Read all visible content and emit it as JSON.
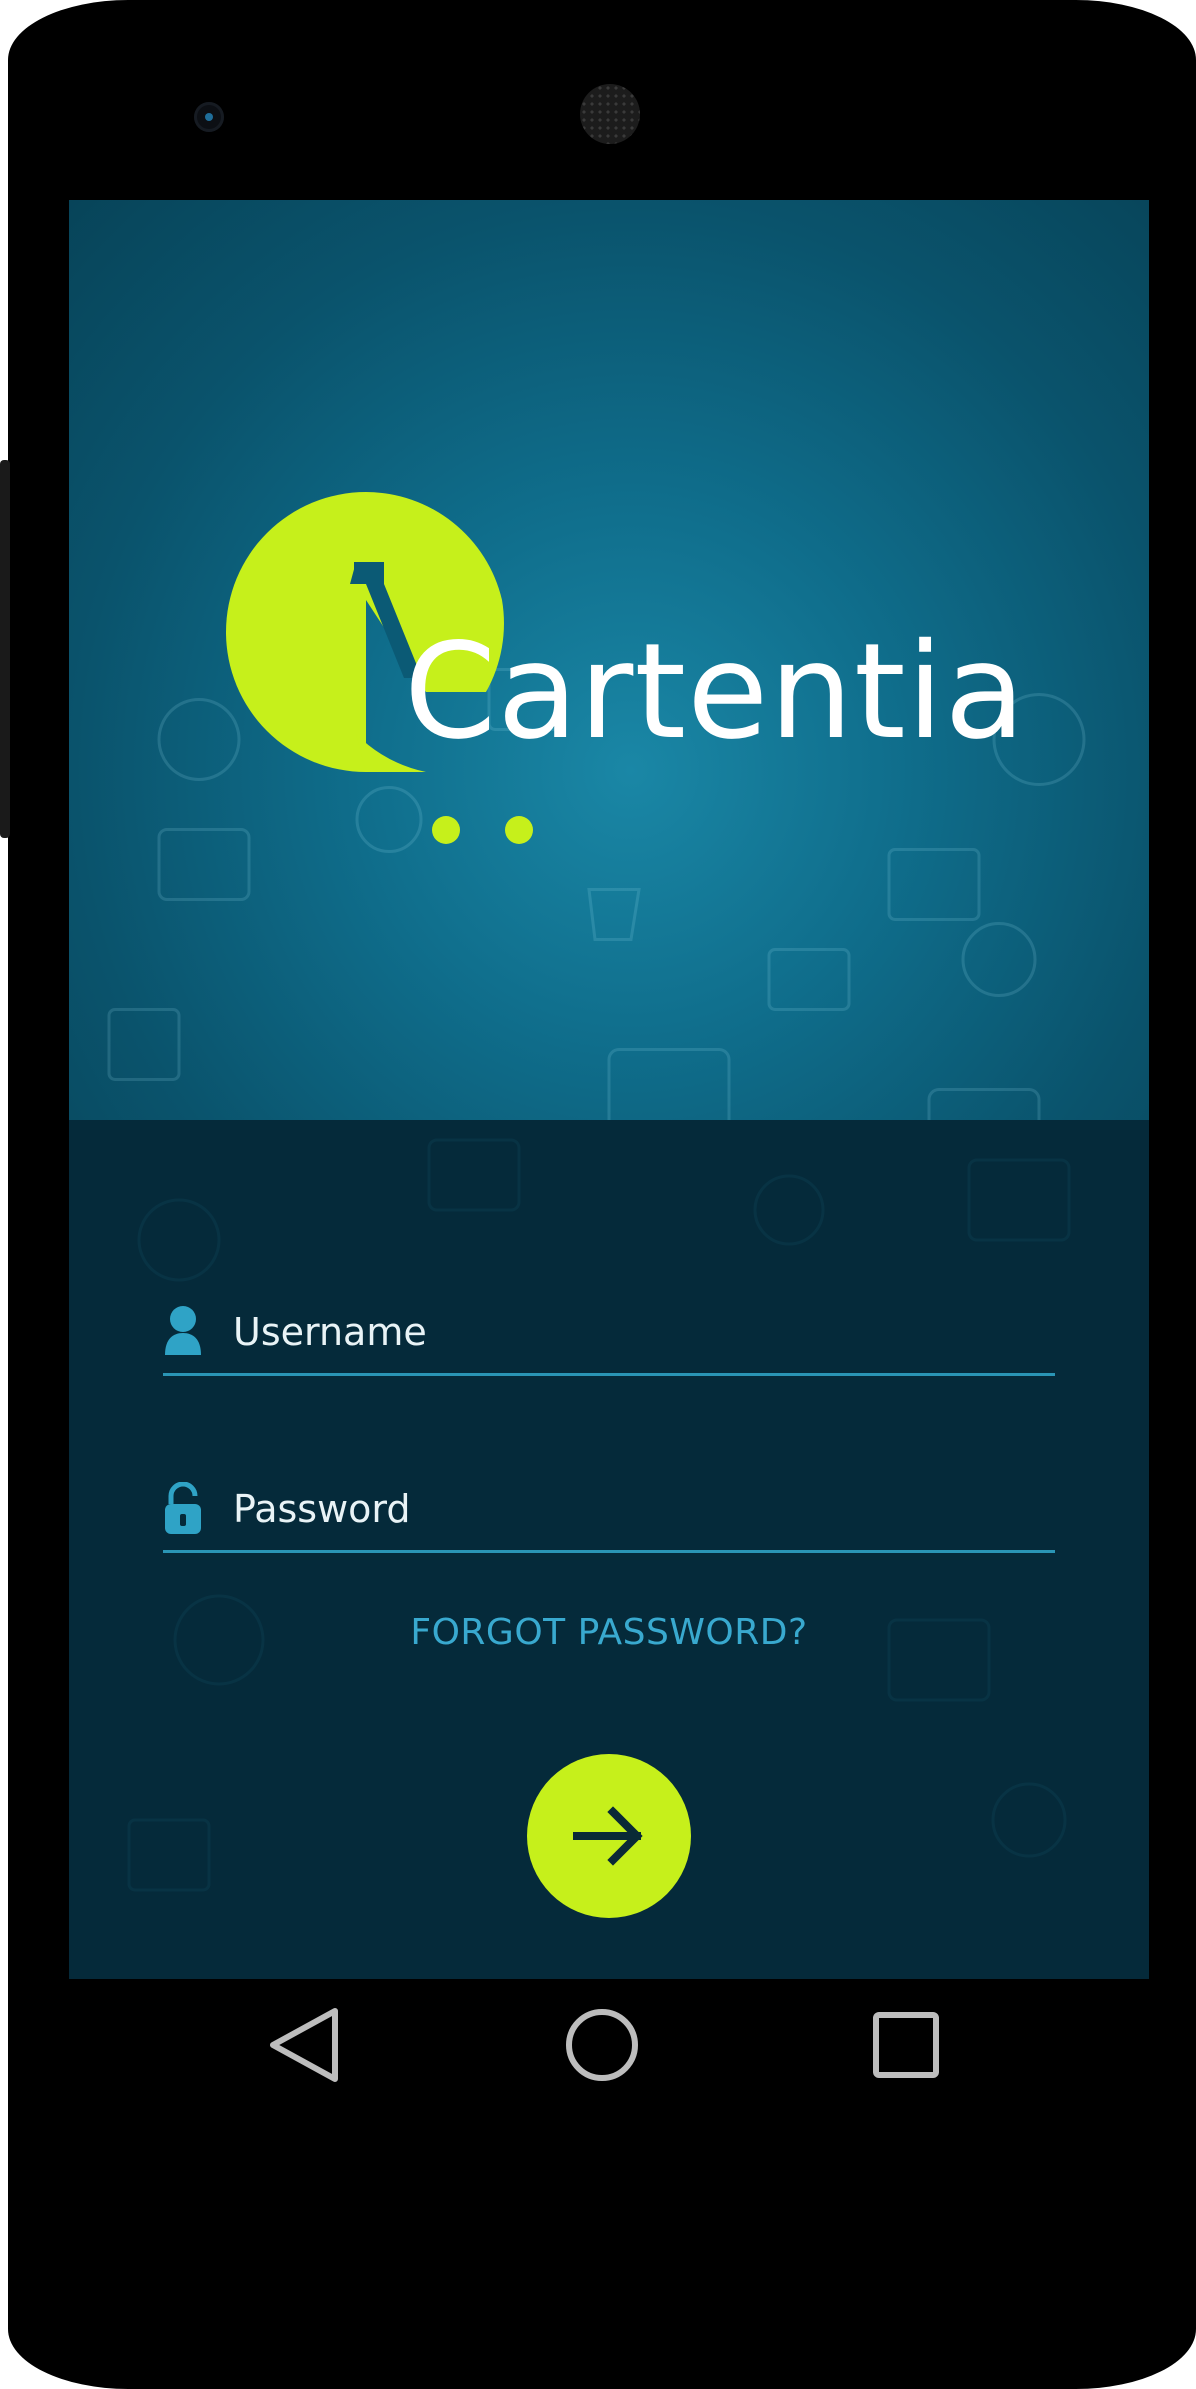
{
  "app": {
    "brand_name": "Cartentia",
    "brand_color": "#c6f01b",
    "background_color": "#0a536c"
  },
  "login": {
    "username_placeholder": "Username",
    "password_placeholder": "Password",
    "username_icon": "user-icon",
    "password_icon": "unlock-icon",
    "forgot_password_label": "FORGOT PASSWORD?",
    "submit_icon": "arrow-right-icon"
  },
  "nav_bar": {
    "back_icon": "back-triangle-icon",
    "home_icon": "home-circle-icon",
    "recents_icon": "recents-square-icon"
  }
}
